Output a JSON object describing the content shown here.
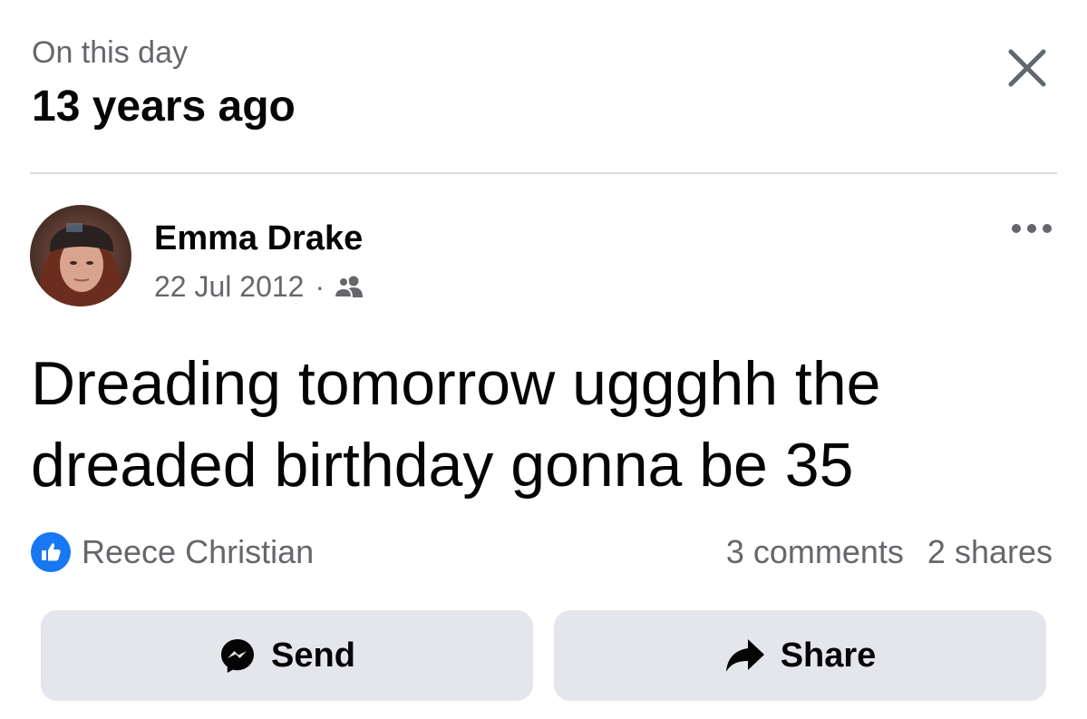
{
  "header": {
    "subtitle": "On this day",
    "title": "13 years ago",
    "close_icon": "close-icon"
  },
  "post": {
    "author": "Emma Drake",
    "date": "22 Jul 2012",
    "separator": "·",
    "audience_icon": "friends-icon",
    "more_icon": "more-icon",
    "text": "Dreading tomorrow uggghh the dreaded birthday gonna be 35",
    "reactions": {
      "icon": "like-icon",
      "names": "Reece Christian"
    },
    "comments": "3 comments",
    "shares": "2 shares"
  },
  "actions": {
    "send_label": "Send",
    "send_icon": "messenger-icon",
    "share_label": "Share",
    "share_icon": "share-arrow-icon"
  },
  "colors": {
    "accent": "#1877f2",
    "secondary_text": "#65676b",
    "button_bg": "#e4e6eb",
    "divider": "#dadde1"
  }
}
